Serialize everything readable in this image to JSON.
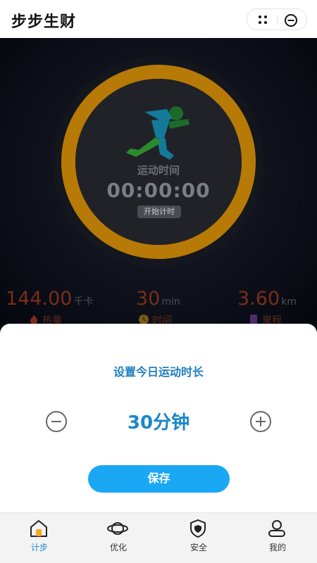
{
  "header": {
    "title": "步步生财"
  },
  "workout": {
    "label": "运动时间",
    "timer": "00:00:00",
    "start_label": "开始计时"
  },
  "stats": [
    {
      "value": "144.00",
      "unit": "千卡",
      "label": "热量"
    },
    {
      "value": "30",
      "unit": "min",
      "label": "时间"
    },
    {
      "value": "3.60",
      "unit": "km",
      "label": "里程"
    }
  ],
  "sheet": {
    "title": "设置今日运动时长",
    "duration": "30分钟",
    "save_label": "保存"
  },
  "tabs": [
    {
      "label": "计步",
      "icon": "home-icon",
      "active": true
    },
    {
      "label": "优化",
      "icon": "planet-icon",
      "active": false
    },
    {
      "label": "安全",
      "icon": "shield-icon",
      "active": false
    },
    {
      "label": "我的",
      "icon": "user-icon",
      "active": false
    }
  ],
  "colors": {
    "ring": "#b77a07",
    "accent": "#1a87c6",
    "save_button": "#1aa8f5",
    "stat_value": "#7a2e1a"
  }
}
